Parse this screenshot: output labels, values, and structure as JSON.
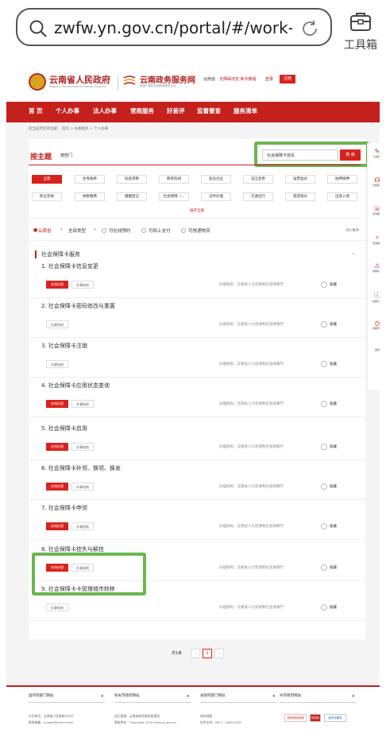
{
  "browser": {
    "url": "zwfw.yn.gov.cn/portal/#/work-s...",
    "toolbox_label": "工具箱"
  },
  "header": {
    "gov_title": "云南省人民政府",
    "gov_subtitle": "People's Government of Yunnan Province",
    "svc_title": "云南政务服务网",
    "svc_subtitle": "全国一体化在线政务服务平台",
    "region": "云南省·",
    "links": "无障碍浏览 新手教程",
    "login": "登录",
    "register": "注册"
  },
  "nav": [
    "首 页",
    "个人办事",
    "法人办事",
    "营商服务",
    "好差评",
    "监督督查",
    "服务清单"
  ],
  "breadcrumb": "您当前所在的位置： 首页 > 办事服务 > 个人办事",
  "theme": {
    "title": "按主题",
    "dept": "按部门",
    "search_value": "社会保障卡挂失",
    "search_btn": "搜 索",
    "expand": "展开全部"
  },
  "categories": [
    [
      "全部",
      "生育收养",
      "民族宗教",
      "教育科研",
      "就业创业",
      "设立变更",
      "准营准办",
      "抵押质押"
    ],
    [
      "职业资格",
      "纳税缴费",
      "婚姻登记",
      "社会保障（...",
      "证件办理",
      "交通出行",
      "旅游观光",
      "出境入境"
    ]
  ],
  "filters": {
    "region": "云南省",
    "type": "全部类型",
    "opts": [
      "可在线预约",
      "可网上支付",
      "可快递物流"
    ],
    "total": "共1事项"
  },
  "group_title": "社会保障卡服务",
  "items": [
    {
      "name": "1. 社会保障卡信息变更",
      "online": true
    },
    {
      "name": "2. 社会保障卡密码修改与重置",
      "online": false
    },
    {
      "name": "3. 社会保障卡注销",
      "online": false
    },
    {
      "name": "4. 社会保障卡应用状态查询",
      "online": true
    },
    {
      "name": "5. 社会保障卡启用",
      "online": true
    },
    {
      "name": "6. 社会保障卡补领、换领、换发",
      "online": true
    },
    {
      "name": "7. 社会保障卡申领",
      "online": true
    },
    {
      "name": "8. 社会保障卡挂失与解挂",
      "online": true
    },
    {
      "name": "9. 社会保障卡卡管理城市转移",
      "online": false
    }
  ],
  "item_labels": {
    "online": "在线办理",
    "guide": "办事指南",
    "agency": "办理机构：云南省人力资源和社会保障厅",
    "fav": "收藏"
  },
  "pager": {
    "total": "共1条",
    "page": "1",
    "prev": "‹",
    "next": "›"
  },
  "footer": {
    "selects": [
      "国务院部门网站",
      "各省市政府网站",
      "省政府部门网站",
      "州市政府网站"
    ],
    "sponsor": "主办单位：云南省人民政府办公厅",
    "email": "联系邮箱：yunwei@yunnl.com",
    "ops": "运行管理：云南省政务服务管理局",
    "copyright": "版权所有：Copyright 2019 zwfw.yn.gov.cn",
    "sitemap": "网站地图",
    "phone": "技术支持：0871 - 64812345",
    "logos": [
      "政府网站找错",
      "党政机关",
      "适老化服务"
    ]
  },
  "sidebar": [
    "办事通",
    "智能客服",
    "咨询服务",
    "查询服务",
    "我要投诉",
    "我要纠错",
    "我要预约",
    "返回"
  ],
  "colors": {
    "brand_red": "#c4201c",
    "button_red": "#d7231d",
    "highlight_green": "#6bb552"
  }
}
